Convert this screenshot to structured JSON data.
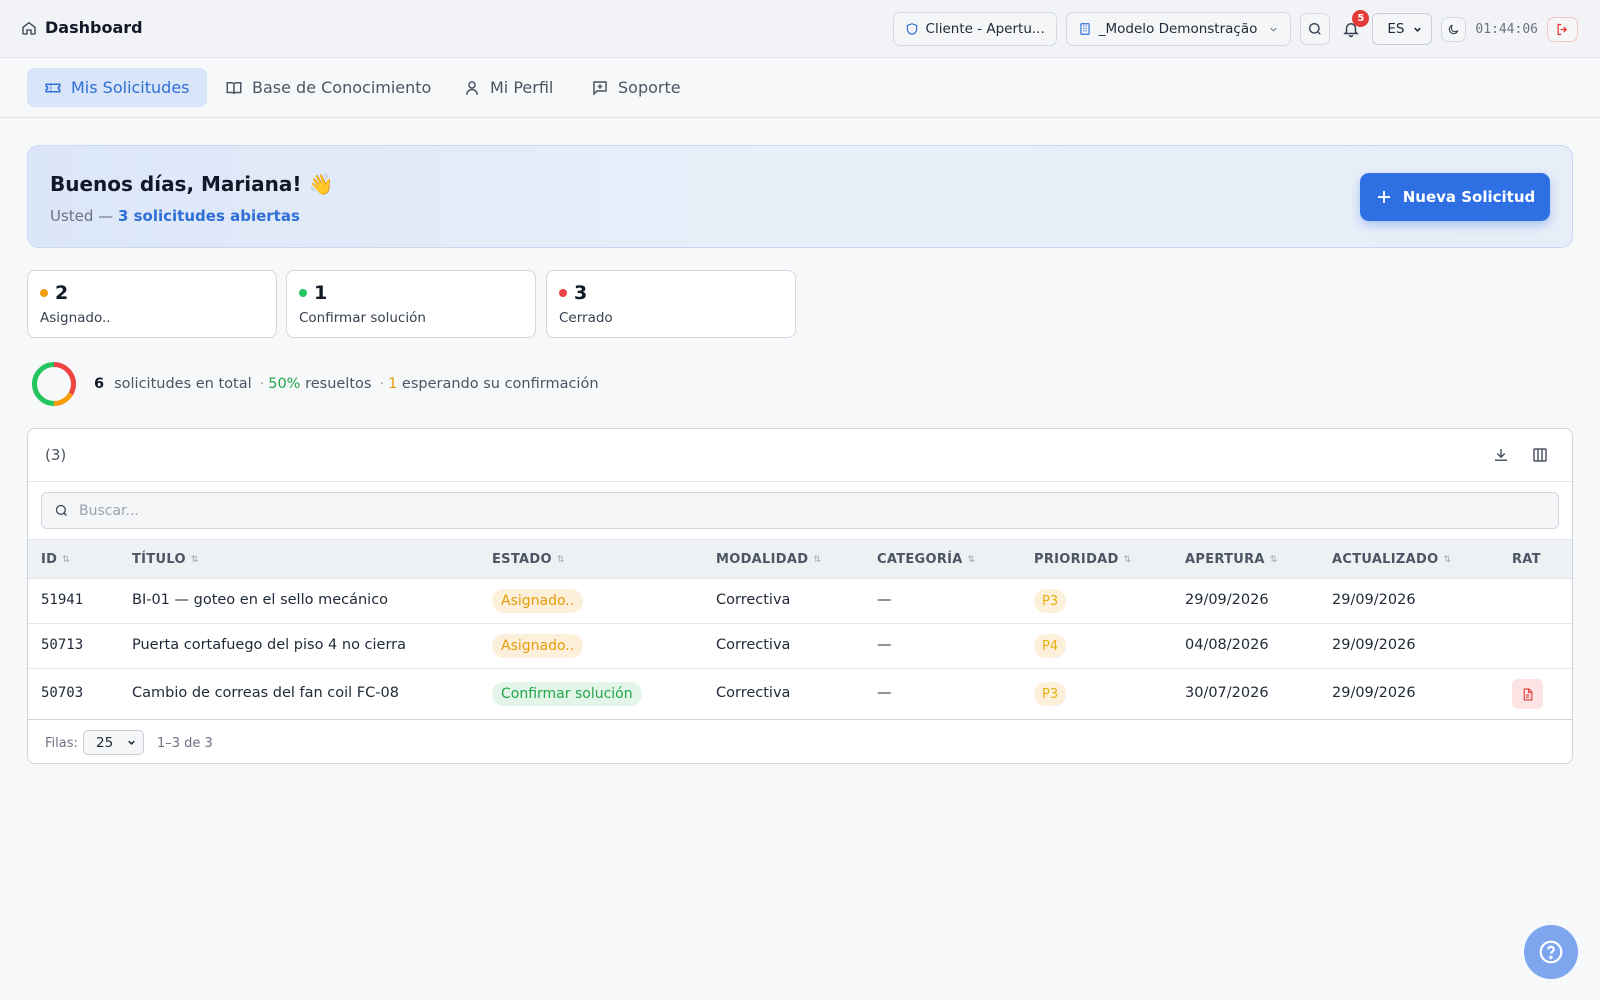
{
  "app": {
    "title": "Dashboard",
    "clock": "01:44:06",
    "notification_count": "5",
    "language": "ES",
    "role_pill": "Cliente - Apertu...",
    "org_pill": "_Modelo Demonstração"
  },
  "nav": {
    "tabs": [
      {
        "label": "Mis Solicitudes",
        "active": true
      },
      {
        "label": "Base de Conocimiento"
      },
      {
        "label": "Mi Perfil"
      },
      {
        "label": "Soporte"
      }
    ]
  },
  "banner": {
    "greeting": "Buenos días, Mariana! 👋",
    "sub_prefix": "Usted — ",
    "sub_highlight": "3 solicitudes abiertas",
    "new_button": "Nueva Solicitud"
  },
  "stats": [
    {
      "value": "2",
      "label": "Asignado..",
      "color": "#f59e0b"
    },
    {
      "value": "1",
      "label": "Confirmar solución",
      "color": "#22c55e"
    },
    {
      "value": "3",
      "label": "Cerrado",
      "color": "#ef4444"
    }
  ],
  "summary": {
    "total": "6",
    "total_label": "solicitudes en total",
    "resolved_pct": "50%",
    "resolved_label": "resueltos",
    "waiting": "1",
    "waiting_label": "esperando su confirmación",
    "donut_resolved_fraction": 0.5
  },
  "table": {
    "count": "(3)",
    "search_placeholder": "Buscar...",
    "columns": [
      "ID",
      "TÍTULO",
      "ESTADO",
      "MODALIDAD",
      "CATEGORÍA",
      "PRIORIDAD",
      "APERTURA",
      "ACTUALIZADO",
      "RAT"
    ],
    "rows": [
      {
        "id": "51941",
        "title": "BI-01 — goteo en el sello mecánico",
        "status": "Asignado..",
        "status_color": "orange",
        "modality": "Correctiva",
        "category": "—",
        "priority": "P3",
        "opened": "29/09/2026",
        "updated": "29/09/2026",
        "rat": false
      },
      {
        "id": "50713",
        "title": "Puerta cortafuego del piso 4 no cierra",
        "status": "Asignado..",
        "status_color": "orange",
        "modality": "Correctiva",
        "category": "—",
        "priority": "P4",
        "opened": "04/08/2026",
        "updated": "29/09/2026",
        "rat": false
      },
      {
        "id": "50703",
        "title": "Cambio de correas del fan coil FC-08",
        "status": "Confirmar solución",
        "status_color": "green",
        "modality": "Correctiva",
        "category": "—",
        "priority": "P3",
        "opened": "30/07/2026",
        "updated": "29/09/2026",
        "rat": true
      }
    ],
    "footer": {
      "rows_label": "Filas:",
      "rows_value": "25",
      "range": "1–3 de 3"
    }
  }
}
